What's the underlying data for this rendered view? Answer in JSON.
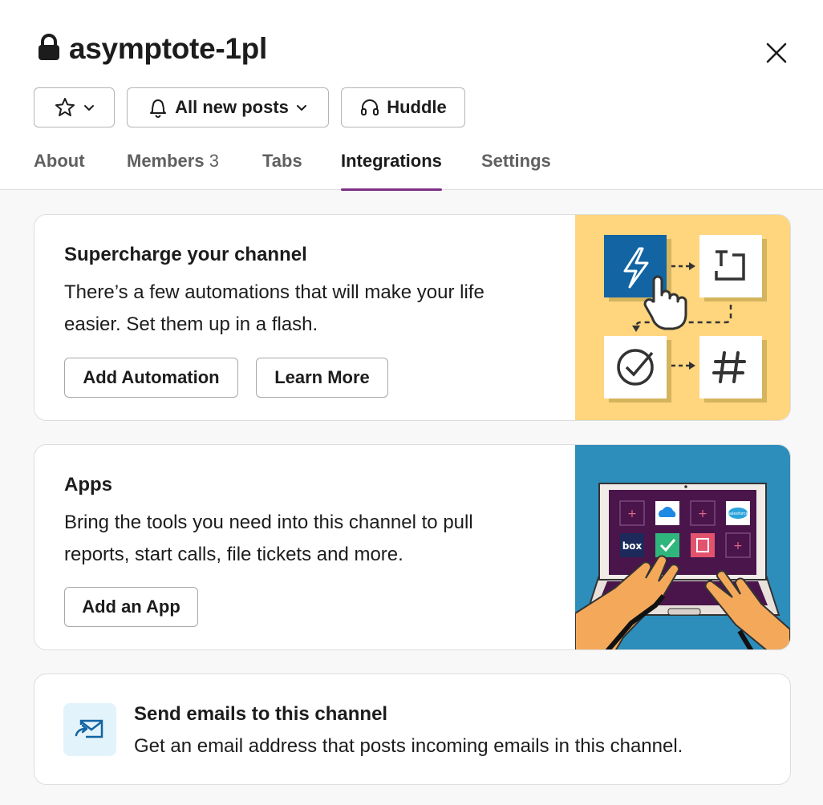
{
  "channel": {
    "name": "asymptote-1pl"
  },
  "toolbar": {
    "notify_label": "All new posts",
    "huddle_label": "Huddle"
  },
  "tabs": [
    {
      "label": "About"
    },
    {
      "label": "Members",
      "count": "3"
    },
    {
      "label": "Tabs"
    },
    {
      "label": "Integrations",
      "active": true
    },
    {
      "label": "Settings"
    }
  ],
  "automation_card": {
    "title": "Supercharge your channel",
    "description_line1": "There’s a few automations that will make your life",
    "description_line2": "easier. Set them up in a flash.",
    "add_label": "Add Automation",
    "learn_label": "Learn More"
  },
  "apps_card": {
    "title": "Apps",
    "description_line1": "Bring the tools you need into this channel to pull",
    "description_line2": "reports, start calls, file tickets and more.",
    "add_label": "Add an App",
    "tile_labels": {
      "box": "box",
      "salesforce": "salesforce"
    }
  },
  "email_card": {
    "title": "Send emails to this channel",
    "description": "Get an email address that posts incoming emails in this channel."
  },
  "colors": {
    "accent": "#7c3085",
    "flash_blue": "#1264a3",
    "yellow_bg": "#ffd57e",
    "blue_bg": "#2d8ebb",
    "laptop_screen": "#4a154b"
  }
}
